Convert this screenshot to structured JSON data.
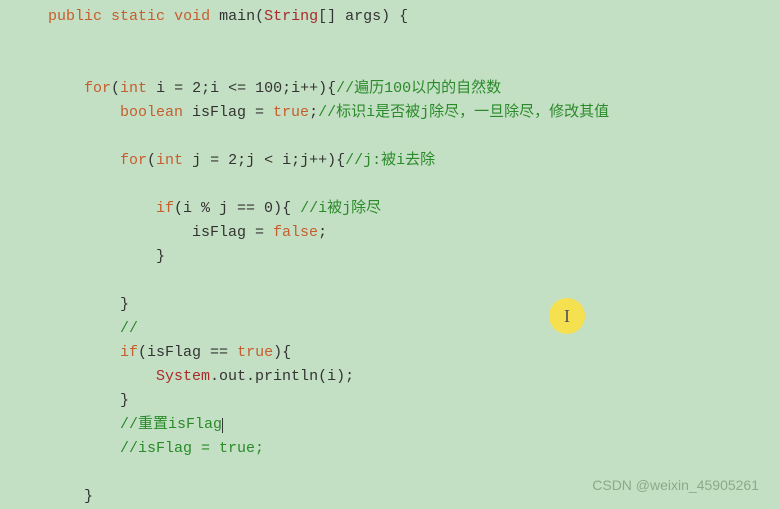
{
  "code": {
    "l1_kw1": "public",
    "l1_kw2": "static",
    "l1_kw3": "void",
    "l1_main": " main(",
    "l1_cls": "String",
    "l1_rest": "[] args) {",
    "l2_for": "for",
    "l2_int": "int",
    "l2_rest1": " i = 2;i <= 100;i++){",
    "l2_cmt": "//遍历100以内的自然数",
    "l3_bool": "boolean",
    "l3_rest": " isFlag = ",
    "l3_true": "true",
    "l3_semi": ";",
    "l3_cmt": "//标识i是否被j除尽，一旦除尽，修改其值",
    "l4_for": "for",
    "l4_int": "int",
    "l4_rest": " j = 2;j < i;j++){",
    "l4_cmt": "//j:被i去除",
    "l5_if": "if",
    "l5_rest": "(i % j == 0){ ",
    "l5_cmt": "//i被j除尽",
    "l6_rest": "isFlag = ",
    "l6_false": "false",
    "l6_semi": ";",
    "l7": "}",
    "l8": "}",
    "l9_cmt": "//",
    "l10_if": "if",
    "l10_rest1": "(isFlag == ",
    "l10_true": "true",
    "l10_rest2": "){",
    "l11_sys": "System",
    "l11_rest": ".out.println(i);",
    "l12": "}",
    "l13_cmt": "//重置isFlag",
    "l14_cmt": "//isFlag = true;",
    "l15": "}"
  },
  "cursor": "I",
  "watermark": "CSDN @weixin_45905261"
}
